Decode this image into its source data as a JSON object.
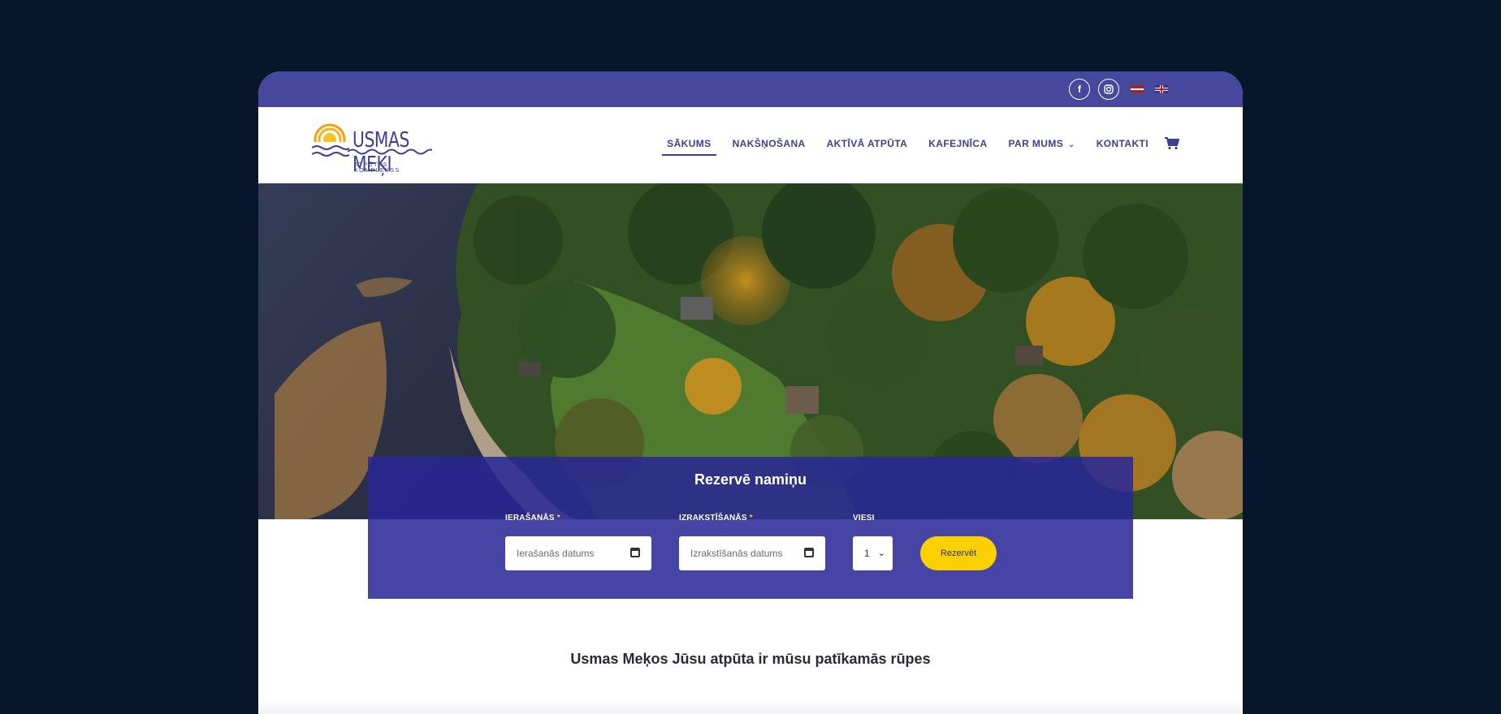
{
  "site": {
    "logo_text": "USMAS MEĶI",
    "logo_subtext": "ATPŪTAS KOMPLEKSS"
  },
  "topbar": {
    "social_icons": [
      "facebook-icon",
      "instagram-icon"
    ],
    "languages": [
      "lv",
      "en"
    ]
  },
  "nav": {
    "items": [
      {
        "label": "SĀKUMS",
        "active": true
      },
      {
        "label": "NAKŠŅOŠANA"
      },
      {
        "label": "AKTĪVĀ ATPŪTA"
      },
      {
        "label": "KAFEJNĪCA"
      },
      {
        "label": "PAR MUMS"
      },
      {
        "label": "KONTAKTI"
      }
    ]
  },
  "booking": {
    "title": "Rezervē namiņu",
    "checkin_label": "IERAŠANĀS",
    "checkin_placeholder": "Ierašanās datums",
    "checkout_label": "IZRAKSTĪŠANĀS",
    "checkout_placeholder": "Izrakstīšanās datums",
    "guests_label": "VIESI",
    "guests_value": "1",
    "submit_label": "Rezervēt",
    "required_marker": "*"
  },
  "main": {
    "tagline": "Usmas Meķos Jūsu atpūta ir mūsu patīkamās rūpes"
  },
  "colors": {
    "brand": "#45489c",
    "accent": "#fad000",
    "page_bg": "#07162a"
  }
}
